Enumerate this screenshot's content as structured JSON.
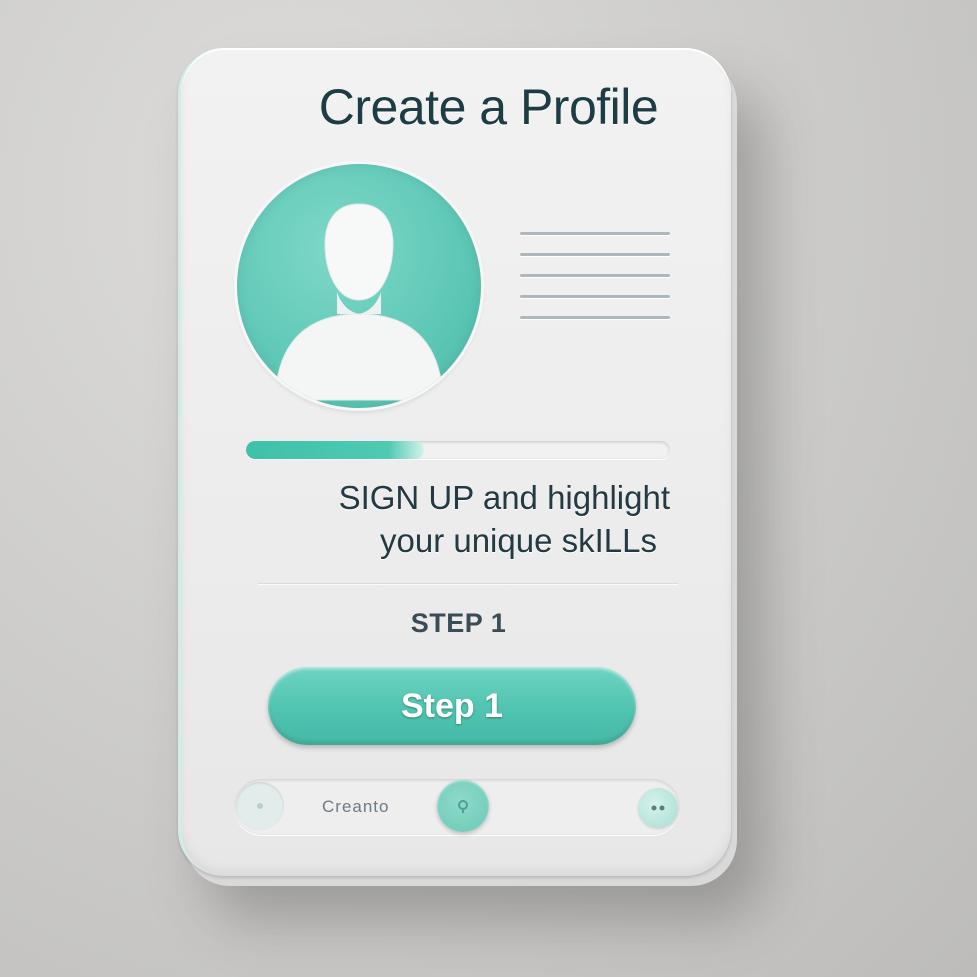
{
  "card": {
    "title": "Create a Profile",
    "subtitle_line1": "SIGN UP and highlight",
    "subtitle_line2": "your unique skILLs",
    "step_label": "STEP 1",
    "step_button_label": "Step 1",
    "progress_fraction": 0.42
  },
  "avatar": {
    "icon": "user-silhouette-icon"
  },
  "text_placeholder_lines": 5,
  "bottom_nav": {
    "text": "Creanto",
    "left_icon": "circle-dot-icon",
    "center_icon": "pin-icon",
    "right_icon": "dots-icon"
  },
  "colors": {
    "accent": "#4fc4b0",
    "title": "#1d3c43",
    "card": "#f0f0f0",
    "background": "#cfcecc"
  }
}
